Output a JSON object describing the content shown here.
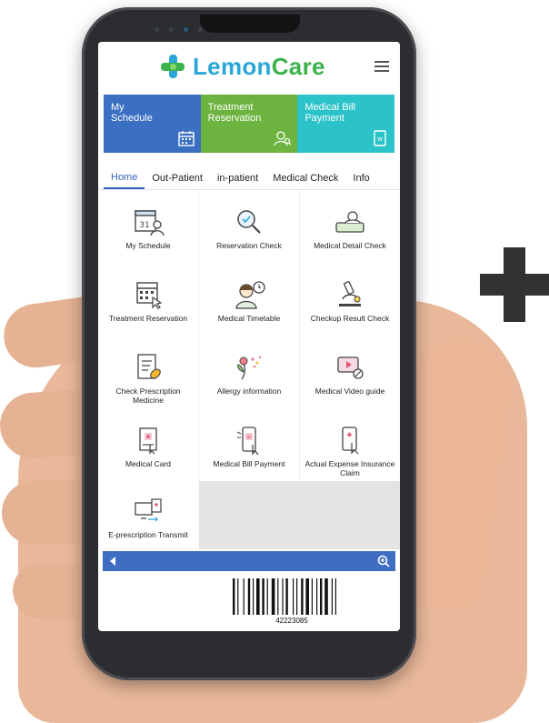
{
  "app": {
    "logo_lemon": "Lemon",
    "logo_care": "Care"
  },
  "banners": [
    {
      "line1": "My",
      "line2": "Schedule",
      "icon": "calendar-icon",
      "color": "#3a6fc2"
    },
    {
      "line1": "Treatment",
      "line2": "Reservation",
      "icon": "user-search-icon",
      "color": "#6db33f"
    },
    {
      "line1": "Medical Bill",
      "line2": "Payment",
      "icon": "bill-icon",
      "color": "#2cc3c8"
    }
  ],
  "tabs": [
    "Home",
    "Out-Patient",
    "in-patient",
    "Medical Check",
    "Info"
  ],
  "active_tab": "Home",
  "menu": [
    {
      "label": "My Schedule",
      "icon": "calendar-user-icon"
    },
    {
      "label": "Reservation Check",
      "icon": "search-check-icon"
    },
    {
      "label": "Medical Detail Check",
      "icon": "patient-bed-icon"
    },
    {
      "label": "Treatment Reservation",
      "icon": "calendar-click-icon"
    },
    {
      "label": "Medical Timetable",
      "icon": "doctor-clock-icon"
    },
    {
      "label": "Checkup Result Check",
      "icon": "microscope-icon"
    },
    {
      "label": "Check Prescription Medicine",
      "icon": "prescription-icon"
    },
    {
      "label": "Allergy information",
      "icon": "allergy-flower-icon"
    },
    {
      "label": "Medical Video guide",
      "icon": "video-play-icon"
    },
    {
      "label": "Medical Card",
      "icon": "medical-card-icon"
    },
    {
      "label": "Medical Bill Payment",
      "icon": "phone-bill-icon"
    },
    {
      "label": "Actual Expense Insurance Claim",
      "icon": "phone-insurance-icon"
    },
    {
      "label": "E-prescription Transmit",
      "icon": "computer-transmit-icon"
    }
  ],
  "barcode": {
    "number": "42223085"
  },
  "colors": {
    "accent": "#2f64bf",
    "lemon": "#2aa7d6",
    "care": "#3bb24a",
    "blue_bar": "#3f6dc2"
  }
}
